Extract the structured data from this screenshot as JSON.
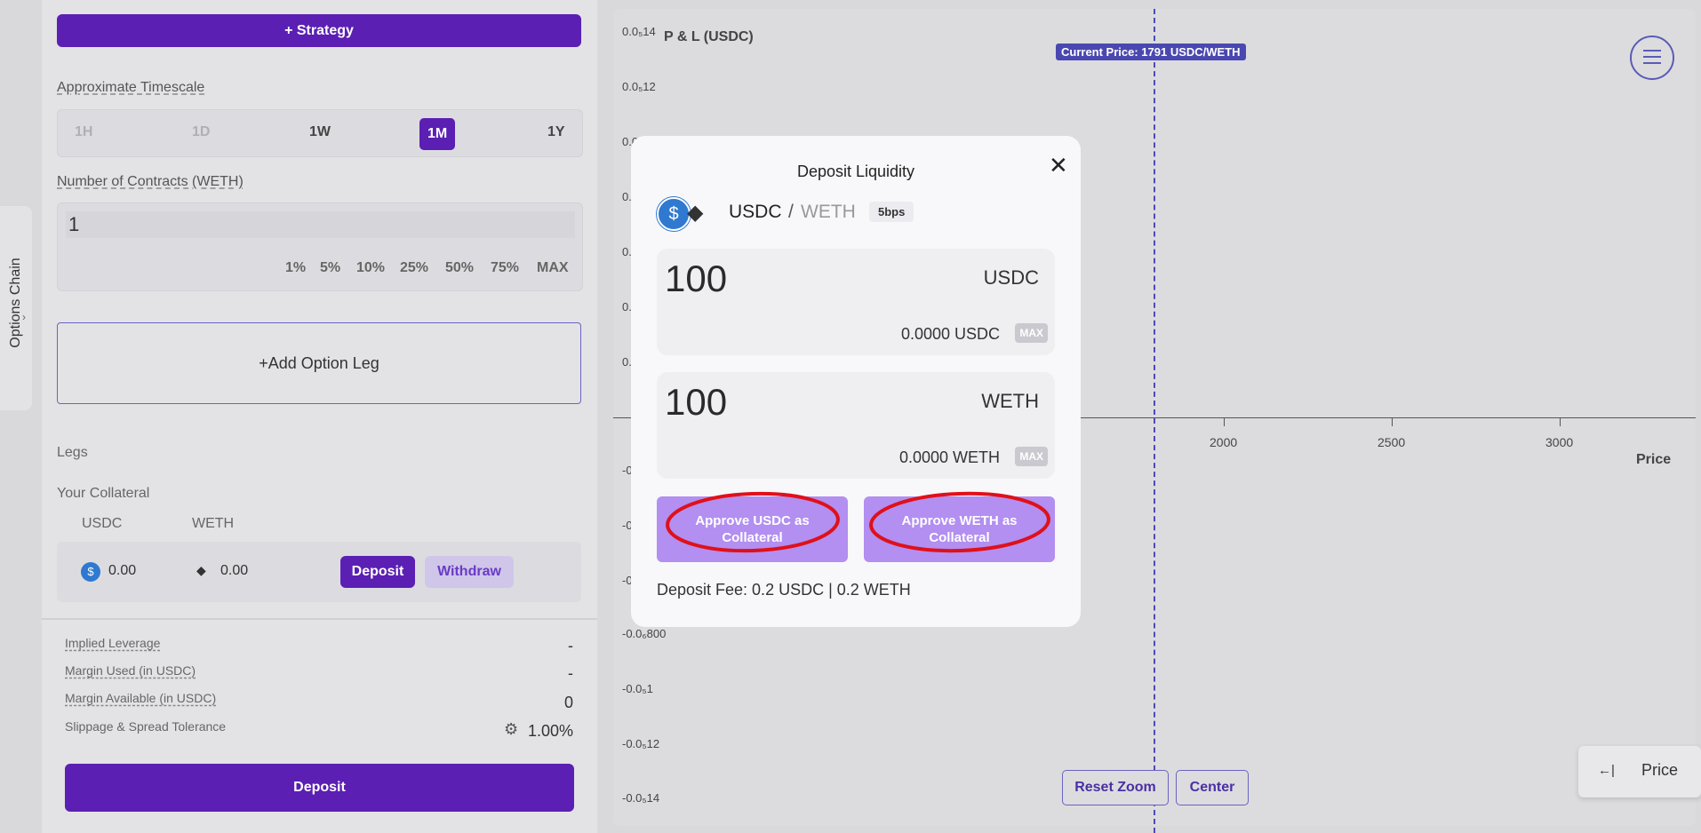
{
  "left": {
    "strategy_button": "+ Strategy",
    "timescale_label": "Approximate Timescale",
    "timescales": [
      "1H",
      "1D",
      "1W",
      "1M",
      "1Y"
    ],
    "active_timescale": "1M",
    "contracts_label": "Number of Contracts (WETH)",
    "contracts_value": "1",
    "percent_options": [
      "1%",
      "5%",
      "10%",
      "25%",
      "50%",
      "75%",
      "MAX"
    ],
    "add_leg": "+Add Option Leg",
    "legs_label": "Legs",
    "collateral_label": "Your Collateral",
    "collateral_usdc_label": "USDC",
    "collateral_weth_label": "WETH",
    "collateral_usdc_value": "0.00",
    "collateral_weth_value": "0.00",
    "deposit_small": "Deposit",
    "withdraw": "Withdraw",
    "stats": {
      "implied_leverage_label": "Implied Leverage",
      "implied_leverage": "-",
      "margin_used_label": "Margin Used (in USDC)",
      "margin_used": "-",
      "margin_available_label": "Margin Available (in USDC)",
      "margin_available": "0",
      "slippage_label": "Slippage & Spread Tolerance",
      "slippage": "1.00%"
    },
    "deposit_main": "Deposit"
  },
  "side_tab": "Options Chain",
  "chart": {
    "y_title": "P & L (USDC)",
    "current_price_tag": "Current Price: 1791 USDC/WETH",
    "y_ticks_top": [
      "0.0₅14",
      "0.0₅12",
      "0.0",
      "0.",
      "0.",
      "0.",
      "0."
    ],
    "y_ticks_bottom": [
      "-0.",
      "-0.",
      "-0.",
      "-0.0₆800",
      "-0.0₅1",
      "-0.0₅12",
      "-0.0₅14"
    ],
    "x_ticks": [
      "2000",
      "2500",
      "3000"
    ],
    "x_label": "Price",
    "reset_zoom": "Reset Zoom",
    "center": "Center",
    "toggle_label": "Price",
    "toggle_arrow": "←|"
  },
  "modal": {
    "title": "Deposit Liquidity",
    "token_a": "USDC",
    "separator": "/",
    "token_b": "WETH",
    "fee_tier": "5bps",
    "usdc_amount": "100",
    "usdc_token": "USDC",
    "usdc_balance": "0.0000 USDC",
    "weth_amount": "100",
    "weth_token": "WETH",
    "weth_balance": "0.0000 WETH",
    "max_label": "MAX",
    "approve_usdc": "Approve USDC as Collateral",
    "approve_weth": "Approve WETH as Collateral",
    "deposit_fee": "Deposit Fee: 0.2 USDC | 0.2 WETH"
  },
  "colors": {
    "primary": "#5b1fb3",
    "approve_button": "#b28ff0",
    "annotation_red": "#e0101a",
    "price_line": "#4b4bb8"
  }
}
